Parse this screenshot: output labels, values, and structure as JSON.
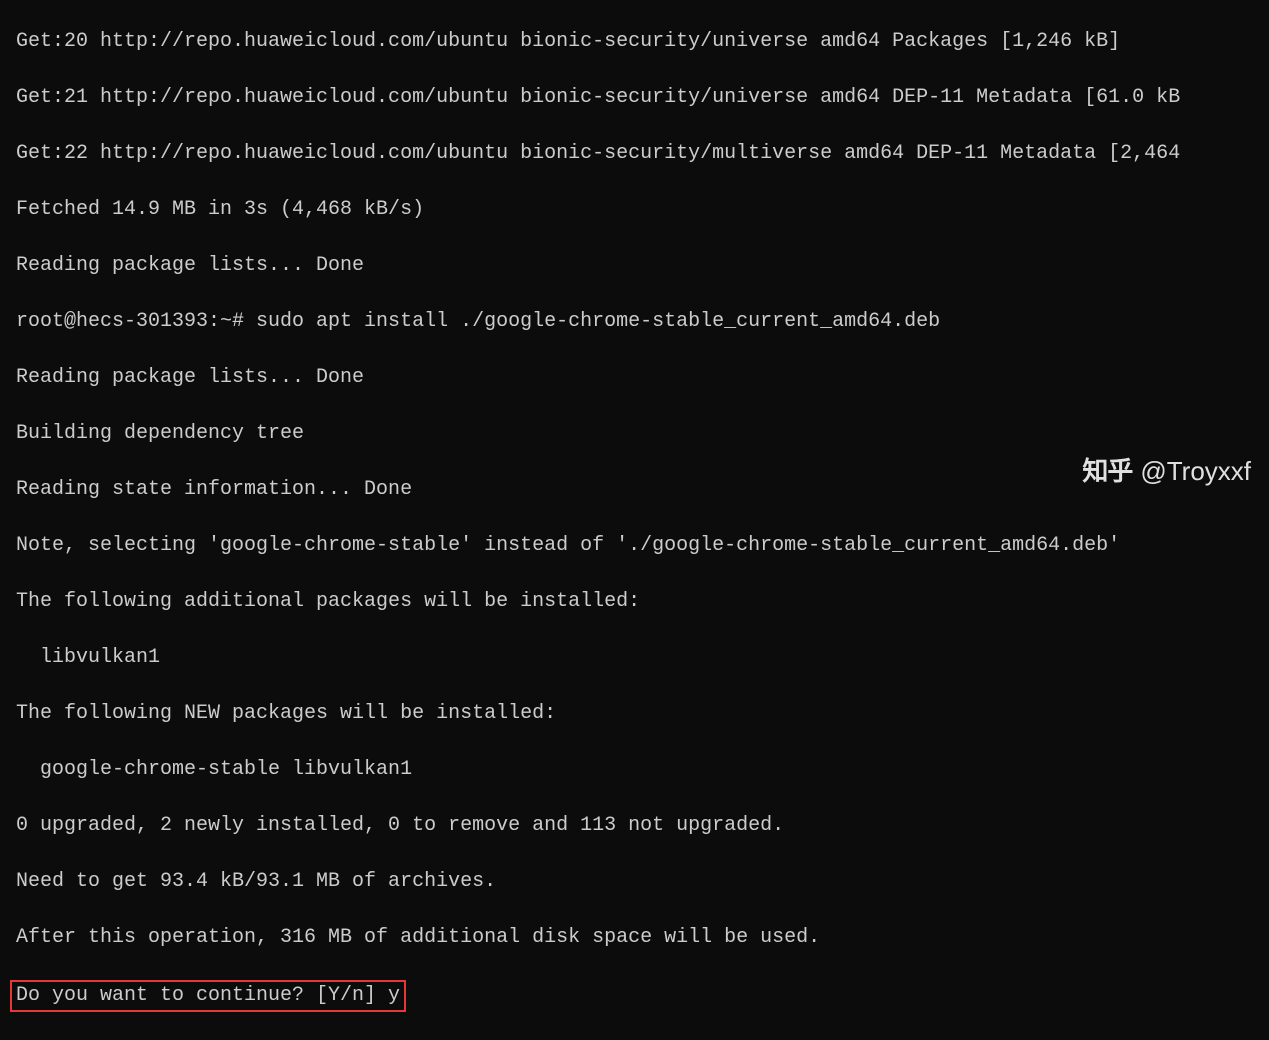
{
  "terminal": {
    "lines": [
      "Get:20 http://repo.huaweicloud.com/ubuntu bionic-security/universe amd64 Packages [1,246 kB]",
      "Get:21 http://repo.huaweicloud.com/ubuntu bionic-security/universe amd64 DEP-11 Metadata [61.0 kB",
      "Get:22 http://repo.huaweicloud.com/ubuntu bionic-security/multiverse amd64 DEP-11 Metadata [2,464",
      "Fetched 14.9 MB in 3s (4,468 kB/s)",
      "Reading package lists... Done",
      "root@hecs-301393:~# sudo apt install ./google-chrome-stable_current_amd64.deb",
      "Reading package lists... Done",
      "Building dependency tree",
      "Reading state information... Done",
      "Note, selecting 'google-chrome-stable' instead of './google-chrome-stable_current_amd64.deb'",
      "The following additional packages will be installed:",
      "  libvulkan1",
      "The following NEW packages will be installed:",
      "  google-chrome-stable libvulkan1",
      "0 upgraded, 2 newly installed, 0 to remove and 113 not upgraded.",
      "Need to get 93.4 kB/93.1 MB of archives.",
      "After this operation, 316 MB of additional disk space will be used."
    ],
    "prompt_line": "Do you want to continue? [Y/n] y"
  },
  "watermark": {
    "logo": "知乎",
    "author": "@Troyxxf"
  }
}
